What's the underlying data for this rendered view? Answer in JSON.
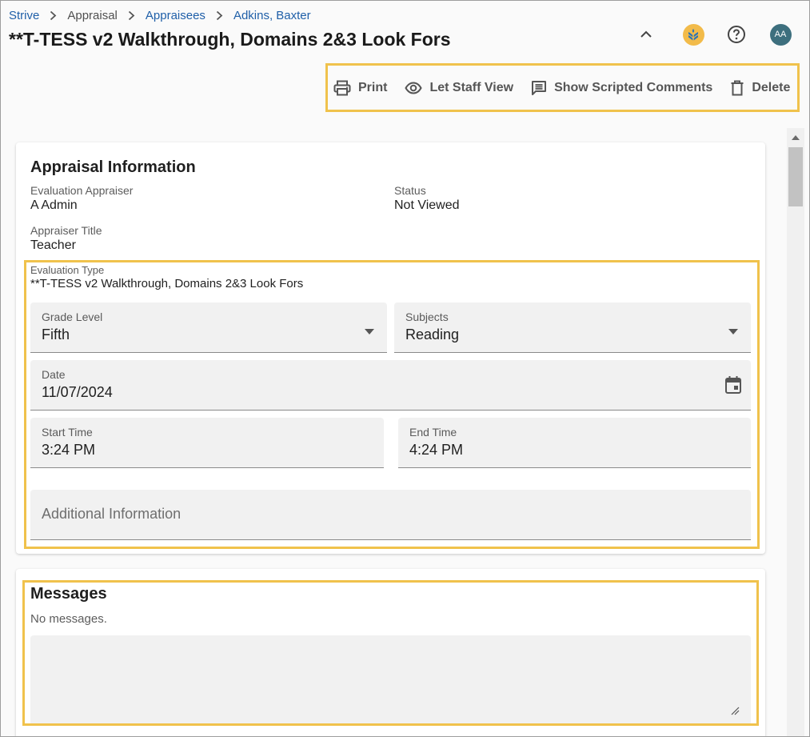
{
  "breadcrumb": {
    "items": [
      {
        "label": "Strive",
        "link": true
      },
      {
        "label": "Appraisal",
        "link": false
      },
      {
        "label": "Appraisees",
        "link": true
      },
      {
        "label": "Adkins, Baxter",
        "link": true
      }
    ]
  },
  "page": {
    "title": "**T-TESS v2 Walkthrough, Domains 2&3 Look Fors"
  },
  "header": {
    "avatar_initials": "AA",
    "icons": [
      "chevron-up-icon",
      "app-logo-icon",
      "help-icon",
      "avatar"
    ]
  },
  "toolbar": {
    "print_label": "Print",
    "staff_view_label": "Let Staff View",
    "scripted_comments_label": "Show Scripted Comments",
    "delete_label": "Delete"
  },
  "appraisal_info": {
    "title": "Appraisal Information",
    "evaluation_appraiser_label": "Evaluation Appraiser",
    "evaluation_appraiser_value": "A Admin",
    "status_label": "Status",
    "status_value": "Not Viewed",
    "appraiser_title_label": "Appraiser Title",
    "appraiser_title_value": "Teacher",
    "evaluation_type_label": "Evaluation Type",
    "evaluation_type_value": "**T-TESS v2 Walkthrough, Domains 2&3 Look Fors",
    "grade_level": {
      "label": "Grade Level",
      "value": "Fifth"
    },
    "subjects": {
      "label": "Subjects",
      "value": "Reading"
    },
    "date": {
      "label": "Date",
      "value": "11/07/2024"
    },
    "start_time": {
      "label": "Start Time",
      "value": "3:24 PM"
    },
    "end_time": {
      "label": "End Time",
      "value": "4:24 PM"
    },
    "additional_info_placeholder": "Additional Information"
  },
  "messages": {
    "title": "Messages",
    "empty_text": "No messages."
  },
  "colors": {
    "highlight": "#f0c24c",
    "link": "#1f5fa8",
    "avatar": "#3d6f7e",
    "logo": "#f2bb4a"
  }
}
